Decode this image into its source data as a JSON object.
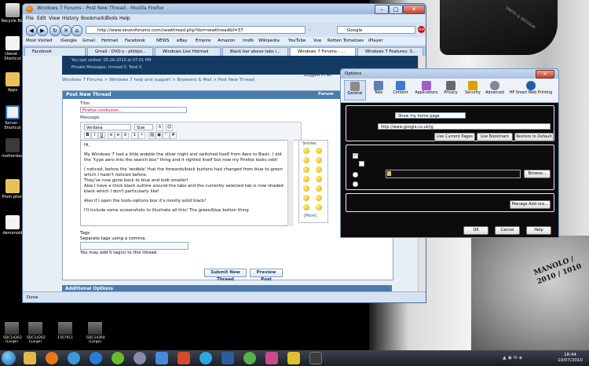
{
  "desktop": {
    "icons": [
      {
        "label": "Recycle Bin"
      },
      {
        "label": "Uwnet - Shortcut"
      },
      {
        "label": "Apps"
      },
      {
        "label": "Server - Shortcut"
      },
      {
        "label": "motherboa"
      },
      {
        "label": "From phon"
      },
      {
        "label": "demonoid"
      }
    ],
    "thumbnails": [
      {
        "label": "SDC14263 (Large)"
      },
      {
        "label": "SDC14262 (Large)"
      },
      {
        "label": "1357911"
      },
      {
        "label": "SDC14264 (Large)"
      }
    ],
    "wallpaper_text": "MANOLO / 2010 / 1010",
    "gun_text": "SMITH & WESSON"
  },
  "browser": {
    "title": "Windows 7 Forums - Post New Thread - Mozilla Firefox",
    "menu": [
      "File",
      "Edit",
      "View",
      "History",
      "Bookmarks",
      "Tools",
      "Help"
    ],
    "url": "http://www.sevenforums.com/newthread.php?do=newthread&f=37",
    "search_engine": "Google",
    "bookmarks": [
      "Most Visited",
      "iGoogle",
      "Gmail",
      "Hotmail",
      "Facebook",
      "NEWS",
      "eBay",
      "Empire",
      "Amazon",
      "imdb",
      "Wikipedia",
      "YouTube",
      "Vue",
      "Rotten Tomatoes",
      "iPlayer"
    ],
    "tabs": [
      {
        "label": "Facebook",
        "active": false
      },
      {
        "label": "Gmail - DVD:s - philipo...",
        "active": false
      },
      {
        "label": "Windows Live Hotmail",
        "active": false
      },
      {
        "label": "Black bar above tabs i...",
        "active": false
      },
      {
        "label": "Windows 7 Forums - ...",
        "active": true
      },
      {
        "label": "Windows 7 Features: S...",
        "active": false
      }
    ],
    "status": "Done"
  },
  "forum": {
    "last_visited": "You last visited: 05-26-2010 at 07:01 PM",
    "private_messages": "Private Messages: Unread 0, Total 0.",
    "breadcrumb": "Windows 7 Forums > Windows 7 help and support > Browsers & Mail > Post New Thread",
    "panel_title": "Post New Thread",
    "forum_link": "Forum",
    "logged_in": "Logged in as",
    "title_label": "Title:",
    "title_value": "Firefox confusion...",
    "message_label": "Message:",
    "font_select": "Verdana",
    "size_select": "Size",
    "smilies_title": "Smilies",
    "smilies_more": "[More]",
    "message_paragraphs": [
      "Hi,",
      "My Windows 7 had a little wobble the other night and switched itself from Aero to Basic. I did the \"type aero into the search box\" thing and it righted itself but now my Firefox looks odd!",
      "I noticed, before the 'wobble' that the forwards/back buttons had changed from blue to green which I hadn't noticed before.\nThey've now gone back to blue and look smaller!\nAlso I have a thick black outline around the tabs and the currently selected tab is now shaded black which I don't particularly like!",
      "Also if I open the tools-options box it's mostly solid black!",
      "I'll include some screenshots to illustrate all this! The green/blue button thing"
    ],
    "tags_label": "Tags",
    "tags_hint": "Separate tags using a comma.",
    "tags_count": "You may add 5 tag(s) to this thread.",
    "submit_button": "Submit New Thread",
    "preview_button": "Preview Post",
    "additional_options": "Additional Options"
  },
  "options_dialog": {
    "title": "Options",
    "tabs": [
      {
        "label": "General",
        "active": true,
        "color": "#8a8a8a"
      },
      {
        "label": "Tabs",
        "active": false,
        "color": "#5b7fb0"
      },
      {
        "label": "Content",
        "active": false,
        "color": "#3a7bd5"
      },
      {
        "label": "Applications",
        "active": false,
        "color": "#a35bd0"
      },
      {
        "label": "Privacy",
        "active": false,
        "color": "#6a6a6a"
      },
      {
        "label": "Security",
        "active": false,
        "color": "#d9a000"
      },
      {
        "label": "Advanced",
        "active": false,
        "color": "#7a8a9a"
      },
      {
        "label": "HP Smart Web Printing",
        "active": false,
        "color": "#1a5fa8"
      }
    ],
    "startup_select": "Show my home page",
    "homepage_value": "http://www.google.co.uk/ig",
    "use_current_pages": "Use Current Pages",
    "use_bookmark": "Use Bookmark",
    "restore_default": "Restore to Default",
    "browse_button": "Browse...",
    "manage_addons": "Manage Add-ons...",
    "ok": "OK",
    "cancel": "Cancel",
    "help": "Help"
  },
  "taskbar": {
    "time": "18:44",
    "date": "10/07/2010",
    "apps": [
      {
        "name": "explorer",
        "color": "#e6b84a"
      },
      {
        "name": "firefox",
        "color": "#e8771c"
      },
      {
        "name": "chrome",
        "color": "#3a9ad9"
      },
      {
        "name": "media-player",
        "color": "#2d7ad6"
      },
      {
        "name": "spotify",
        "color": "#6dba2c"
      },
      {
        "name": "itunes",
        "color": "#8a8aa8"
      },
      {
        "name": "app",
        "color": "#4a8ad8"
      },
      {
        "name": "mail",
        "color": "#d44a2c"
      },
      {
        "name": "skype",
        "color": "#2aa7e0"
      },
      {
        "name": "photoshop",
        "color": "#2b5e9a"
      },
      {
        "name": "messenger",
        "color": "#5ab04a"
      },
      {
        "name": "app2",
        "color": "#c84a8a"
      },
      {
        "name": "app3",
        "color": "#e0c030"
      },
      {
        "name": "app4",
        "color": "#3a3a3a"
      }
    ]
  }
}
